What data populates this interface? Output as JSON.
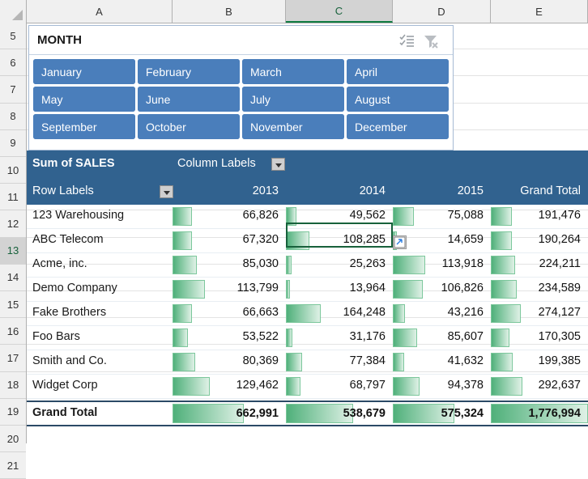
{
  "app": "excel-pivot-table",
  "grid": {
    "columns": [
      {
        "label": "A",
        "active": false
      },
      {
        "label": "B",
        "active": false
      },
      {
        "label": "C",
        "active": true
      },
      {
        "label": "D",
        "active": false
      },
      {
        "label": "E",
        "active": false
      }
    ],
    "rows": [
      "5",
      "6",
      "7",
      "8",
      "9",
      "10",
      "11",
      "12",
      "13",
      "14",
      "15",
      "16",
      "17",
      "18",
      "19",
      "20",
      "21"
    ],
    "active_row": "13",
    "active_cell": "C13"
  },
  "slicer": {
    "title": "MONTH",
    "multiselect_icon": "multi-select-icon",
    "clear_filter_icon": "clear-filter-icon",
    "selected_color": "#4a7ebb",
    "items": [
      "January",
      "February",
      "March",
      "April",
      "May",
      "June",
      "July",
      "August",
      "September",
      "October",
      "November",
      "December"
    ]
  },
  "pivot": {
    "value_field_label": "Sum of SALES",
    "column_labels": "Column Labels",
    "row_labels": "Row Labels",
    "header_color": "#31628f",
    "columns": [
      "2013",
      "2014",
      "2015",
      "Grand Total"
    ],
    "grand_total_label": "Grand Total",
    "databar_color": "#4fb07a"
  },
  "chart_data": {
    "type": "table",
    "title": "Sum of SALES",
    "categories": [
      "123 Warehousing",
      "ABC Telecom",
      "Acme, inc.",
      "Demo Company",
      "Fake Brothers",
      "Foo Bars",
      "Smith and Co.",
      "Widget Corp"
    ],
    "series": [
      {
        "name": "2013",
        "values": [
          66826,
          67320,
          85030,
          113799,
          66663,
          53522,
          80369,
          129462
        ]
      },
      {
        "name": "2014",
        "values": [
          49562,
          108285,
          25263,
          13964,
          164248,
          31176,
          77384,
          68797
        ]
      },
      {
        "name": "2015",
        "values": [
          75088,
          14659,
          113918,
          106826,
          43216,
          85607,
          41632,
          94378
        ]
      },
      {
        "name": "Grand Total",
        "values": [
          191476,
          190264,
          224211,
          234589,
          274127,
          170305,
          199385,
          292637
        ]
      }
    ],
    "totals": {
      "2013": 662991,
      "2014": 538679,
      "2015": 575324,
      "Grand Total": 1776994
    },
    "rows": [
      {
        "name": "123 Warehousing",
        "cells": [
          "66,826",
          "49,562",
          "75,088",
          "191,476"
        ]
      },
      {
        "name": "ABC Telecom",
        "cells": [
          "67,320",
          "108,285",
          "14,659",
          "190,264"
        ]
      },
      {
        "name": "Acme, inc.",
        "cells": [
          "85,030",
          "25,263",
          "113,918",
          "224,211"
        ]
      },
      {
        "name": "Demo Company",
        "cells": [
          "113,799",
          "13,964",
          "106,826",
          "234,589"
        ]
      },
      {
        "name": "Fake Brothers",
        "cells": [
          "66,663",
          "164,248",
          "43,216",
          "274,127"
        ]
      },
      {
        "name": "Foo Bars",
        "cells": [
          "53,522",
          "31,176",
          "85,607",
          "170,305"
        ]
      },
      {
        "name": "Smith and Co.",
        "cells": [
          "80,369",
          "77,384",
          "41,632",
          "199,385"
        ]
      },
      {
        "name": "Widget Corp",
        "cells": [
          "129,462",
          "68,797",
          "94,378",
          "292,637"
        ]
      }
    ],
    "total_row": {
      "name": "Grand Total",
      "cells": [
        "662,991",
        "538,679",
        "575,324",
        "1,776,994"
      ]
    },
    "ylabel": "",
    "xlabel": ""
  }
}
